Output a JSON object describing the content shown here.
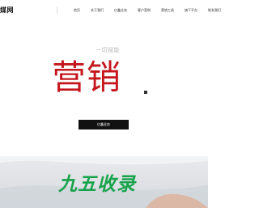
{
  "header": {
    "logo_text": "媒网",
    "nav": [
      {
        "label": "首页"
      },
      {
        "label": "关于我们"
      },
      {
        "label": "亿鑫业务"
      },
      {
        "label": "客户案例"
      },
      {
        "label": "营销工具"
      },
      {
        "label": "旗下平台"
      },
      {
        "label": "联系我们"
      }
    ]
  },
  "hero": {
    "subtitle": "一切赋能",
    "title": "营销",
    "cta_label": "亿鑫业务"
  },
  "banner": {
    "title": "九五收录"
  },
  "colors": {
    "brand_red": "#c5161d",
    "banner_green": "#17a34a",
    "button_bg": "#111111"
  }
}
